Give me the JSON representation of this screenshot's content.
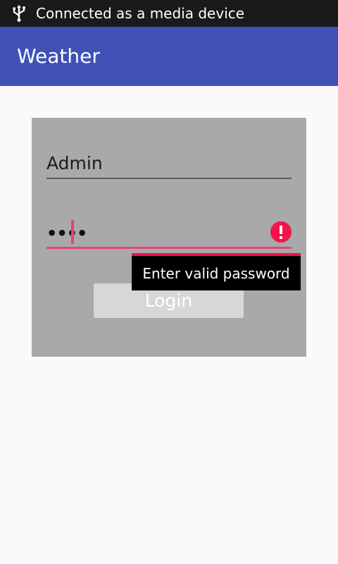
{
  "status_bar": {
    "icon": "usb-icon",
    "notification": "Connected as a media device"
  },
  "app_bar": {
    "title": "Weather"
  },
  "login_form": {
    "username_value": "Admin",
    "password_value": "••••",
    "error_icon": "error-exclamation-icon",
    "login_label": "Login",
    "error_message": "Enter valid password"
  },
  "colors": {
    "app_bar": "#3f51b5",
    "card": "#a9a9a9",
    "accent": "#ec407a",
    "error": "#f0144a",
    "status_bar": "#1a1a1a"
  }
}
